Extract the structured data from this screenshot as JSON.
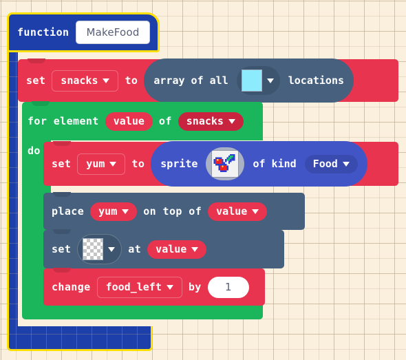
{
  "editor": {
    "name": "blocks-workspace",
    "background_color": "#fbf0dd",
    "grid_color": "#beaa8c"
  },
  "colors": {
    "function_block": "#1d3faa",
    "variables_block": "#e8344e",
    "loops_block": "#1bb55c",
    "scene_block": "#46607e",
    "sprites_block": "#4255c7",
    "selection_highlight": "#ffe000",
    "tile_cyan": "#8cecfd"
  },
  "function_block": {
    "keyword": "function",
    "name_value": "MakeFood",
    "selected": true
  },
  "statements": [
    {
      "id": "set-snacks",
      "category": "variables",
      "label_set": "set",
      "variable": "snacks",
      "label_to": "to",
      "value_block": {
        "category": "scene",
        "label_prefix": "array of all",
        "tile": "cyan-tile",
        "label_suffix": "locations"
      }
    },
    {
      "id": "for-element",
      "category": "loops",
      "label_for_element": "for element",
      "element_var": "value",
      "label_of": "of",
      "list_var": "snacks",
      "label_do": "do"
    },
    {
      "id": "set-yum",
      "category": "variables",
      "label_set": "set",
      "variable": "yum",
      "label_to": "to",
      "value_block": {
        "category": "sprites",
        "label_prefix": "sprite",
        "image": "cherries-sprite",
        "label_of_kind": "of kind",
        "kind": "Food"
      }
    },
    {
      "id": "place-on-top-of",
      "category": "scene",
      "label_place": "place",
      "sprite_var": "yum",
      "label_on_top_of": "on top of",
      "location_var": "value"
    },
    {
      "id": "set-tile-at",
      "category": "scene",
      "label_set": "set",
      "tile": "transparent-tile",
      "label_at": "at",
      "location_var": "value"
    },
    {
      "id": "change-by",
      "category": "variables",
      "label_change": "change",
      "variable": "food_left",
      "label_by": "by",
      "amount": "1"
    }
  ]
}
